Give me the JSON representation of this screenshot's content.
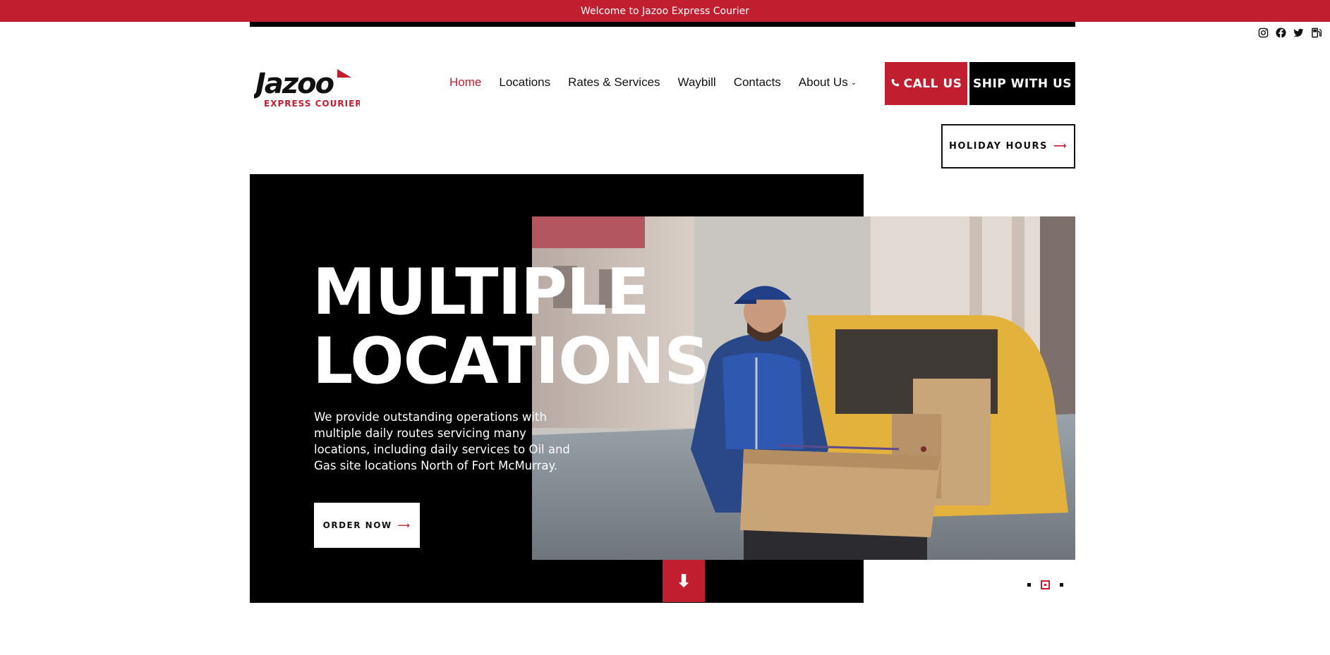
{
  "topbar": {
    "welcome": "Welcome to Jazoo Express Courier"
  },
  "social": [
    "instagram-icon",
    "facebook-icon",
    "twitter-icon",
    "fuel-icon"
  ],
  "logo": {
    "name": "Jazoo",
    "tagline": "EXPRESS COURIER"
  },
  "nav": {
    "items": [
      {
        "label": "Home",
        "active": true
      },
      {
        "label": "Locations"
      },
      {
        "label": "Rates & Services"
      },
      {
        "label": "Waybill"
      },
      {
        "label": "Contacts"
      },
      {
        "label": "About Us",
        "dropdown": true
      }
    ]
  },
  "buttons": {
    "call": "CALL US",
    "ship": "SHIP WITH US",
    "holiday": "HOLIDAY HOURS",
    "order": "ORDER NOW"
  },
  "hero": {
    "title_line1": "MULTIPLE",
    "title_line2": "LOCATIONS",
    "text": "We provide outstanding operations with multiple daily routes servicing many locations, including daily services to Oil and Gas site locations North of Fort McMurray."
  },
  "slider": {
    "count": 3,
    "active_index": 2
  },
  "colors": {
    "brand_red": "#c11e30",
    "black": "#000000"
  }
}
